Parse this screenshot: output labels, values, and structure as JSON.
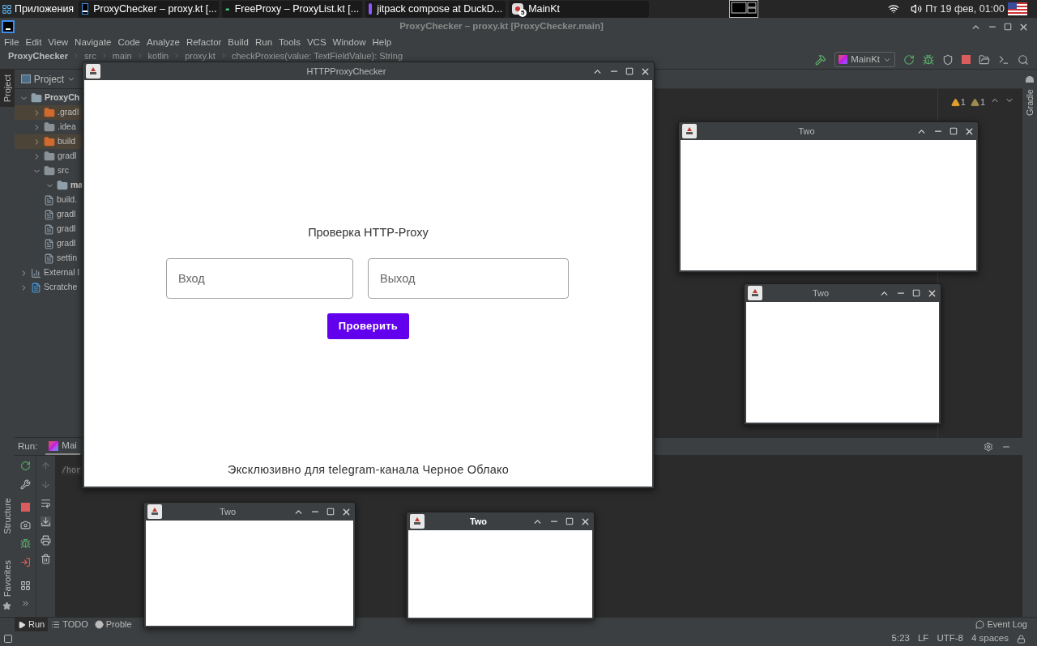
{
  "taskbar": {
    "apps_label": "Приложения",
    "tasks": [
      {
        "title": "ProxyChecker – proxy.kt [..."
      },
      {
        "title": "FreeProxy – ProxyList.kt [..."
      },
      {
        "title": "jitpack compose at DuckD..."
      },
      {
        "title": "MainKt",
        "badge": "5"
      }
    ],
    "clock": "Пт 19 фев, 01:00"
  },
  "ide": {
    "title": "ProxyChecker – proxy.kt [ProxyChecker.main]",
    "menu": [
      "File",
      "Edit",
      "View",
      "Navigate",
      "Code",
      "Analyze",
      "Refactor",
      "Build",
      "Run",
      "Tools",
      "VCS",
      "Window",
      "Help"
    ],
    "breadcrumbs": [
      "ProxyChecker",
      "src",
      "main",
      "kotlin",
      "proxy.kt",
      "checkProxies(value: TextFieldValue): String"
    ],
    "run_config": "MainKt",
    "left_tools": [
      {
        "label": "Project",
        "selected": true
      },
      {
        "label": "Structure",
        "selected": false
      },
      {
        "label": "Favorites",
        "selected": false
      }
    ],
    "right_tools": [
      {
        "label": "Gradle",
        "selected": false
      }
    ],
    "project": {
      "header": "Project",
      "tree": [
        {
          "kind": "module",
          "label": "ProxyCh",
          "expanded": true,
          "children": [
            {
              "kind": "folder",
              "label": ".gradl",
              "expanded": false,
              "excluded": true
            },
            {
              "kind": "folder",
              "label": ".idea",
              "expanded": false,
              "excluded": false
            },
            {
              "kind": "folder",
              "label": "build",
              "expanded": false,
              "excluded": true
            },
            {
              "kind": "folder",
              "label": "gradl",
              "expanded": false,
              "excluded": false
            },
            {
              "kind": "folder",
              "label": "src",
              "expanded": true,
              "excluded": false,
              "children": [
                {
                  "kind": "module",
                  "label": "ma",
                  "expanded": true
                }
              ]
            },
            {
              "kind": "file",
              "label": "build."
            },
            {
              "kind": "file",
              "label": "gradl"
            },
            {
              "kind": "file",
              "label": "gradl"
            },
            {
              "kind": "file",
              "label": "gradl"
            },
            {
              "kind": "file",
              "label": "settin"
            }
          ]
        },
        {
          "kind": "library",
          "label": "External l",
          "expanded": false
        },
        {
          "kind": "scratch",
          "label": "Scratche",
          "expanded": false
        }
      ]
    },
    "warnings": [
      "1",
      "1"
    ],
    "run": {
      "label": "Run:",
      "tab": "Mai",
      "output": "/hor"
    },
    "bottom_tabs": [
      {
        "label": "Run",
        "selected": true
      },
      {
        "label": "TODO",
        "selected": false
      },
      {
        "label": "Proble",
        "selected": false
      }
    ],
    "event_log": "Event Log",
    "status": [
      "5:23",
      "LF",
      "UTF-8",
      "4 spaces"
    ]
  },
  "windows": [
    {
      "kind": "main",
      "title": "HTTPProxyChecker",
      "focused": false,
      "heading": "Проверка HTTP-Proxy",
      "fields": [
        {
          "placeholder": "Вход"
        },
        {
          "placeholder": "Выход"
        }
      ],
      "button": "Проверить",
      "footer": "Эксклюзивно для telegram-канала Черное Облако"
    },
    {
      "kind": "blank",
      "title": "Two",
      "focused": false
    },
    {
      "kind": "blank",
      "title": "Two",
      "focused": false
    },
    {
      "kind": "blank",
      "title": "Two",
      "focused": false
    },
    {
      "kind": "blank",
      "title": "Two",
      "focused": true
    }
  ]
}
